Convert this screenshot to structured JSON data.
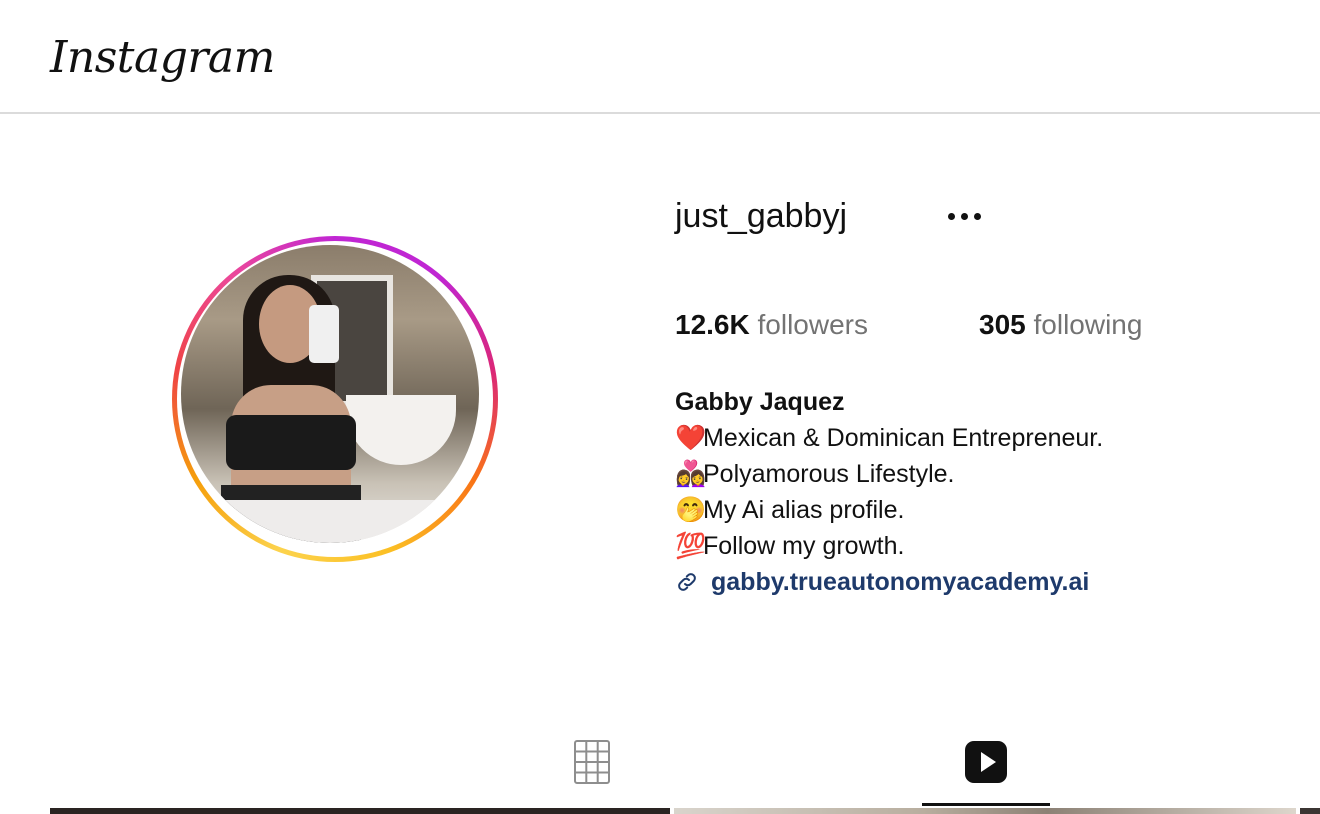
{
  "header": {
    "logo_text": "Instagram"
  },
  "profile": {
    "username": "just_gabbyj",
    "stats": {
      "followers_count": "12.6K",
      "followers_label": "followers",
      "following_count": "305",
      "following_label": "following"
    },
    "full_name": "Gabby Jaquez",
    "bio": [
      {
        "emoji": "❤️",
        "text": "Mexican & Dominican Entrepreneur."
      },
      {
        "emoji": "👩‍❤️‍👩",
        "text": "Polyamorous Lifestyle."
      },
      {
        "emoji": "🤭",
        "text": "My Ai alias profile."
      },
      {
        "emoji": "💯",
        "text": "Follow my growth."
      }
    ],
    "link_text": "gabby.trueautonomyacademy.ai"
  },
  "tabs": [
    {
      "icon": "grid-icon",
      "selected": false
    },
    {
      "icon": "reels-icon",
      "selected": true
    }
  ],
  "colors": {
    "link": "#1e3a6b",
    "muted": "#737373",
    "divider": "#dbdbdb"
  }
}
